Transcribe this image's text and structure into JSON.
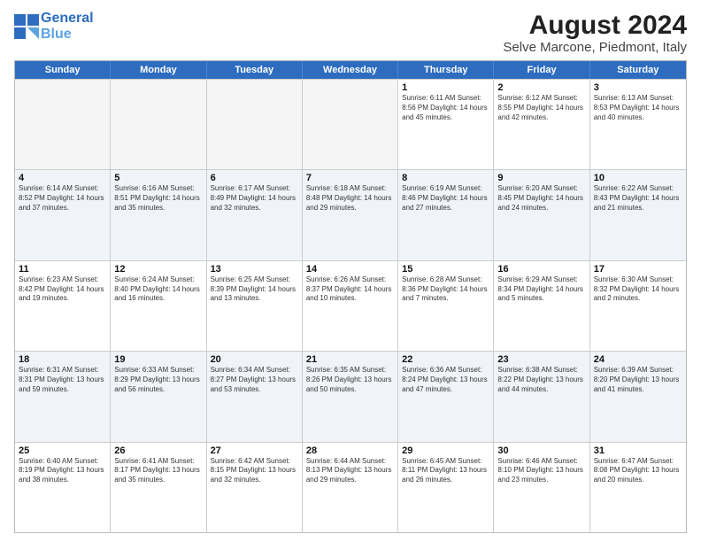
{
  "header": {
    "logo_line1": "General",
    "logo_line2": "Blue",
    "title": "August 2024",
    "subtitle": "Selve Marcone, Piedmont, Italy"
  },
  "weekdays": [
    "Sunday",
    "Monday",
    "Tuesday",
    "Wednesday",
    "Thursday",
    "Friday",
    "Saturday"
  ],
  "rows": [
    [
      {
        "day": "",
        "info": ""
      },
      {
        "day": "",
        "info": ""
      },
      {
        "day": "",
        "info": ""
      },
      {
        "day": "",
        "info": ""
      },
      {
        "day": "1",
        "info": "Sunrise: 6:11 AM\nSunset: 8:56 PM\nDaylight: 14 hours\nand 45 minutes."
      },
      {
        "day": "2",
        "info": "Sunrise: 6:12 AM\nSunset: 8:55 PM\nDaylight: 14 hours\nand 42 minutes."
      },
      {
        "day": "3",
        "info": "Sunrise: 6:13 AM\nSunset: 8:53 PM\nDaylight: 14 hours\nand 40 minutes."
      }
    ],
    [
      {
        "day": "4",
        "info": "Sunrise: 6:14 AM\nSunset: 8:52 PM\nDaylight: 14 hours\nand 37 minutes."
      },
      {
        "day": "5",
        "info": "Sunrise: 6:16 AM\nSunset: 8:51 PM\nDaylight: 14 hours\nand 35 minutes."
      },
      {
        "day": "6",
        "info": "Sunrise: 6:17 AM\nSunset: 8:49 PM\nDaylight: 14 hours\nand 32 minutes."
      },
      {
        "day": "7",
        "info": "Sunrise: 6:18 AM\nSunset: 8:48 PM\nDaylight: 14 hours\nand 29 minutes."
      },
      {
        "day": "8",
        "info": "Sunrise: 6:19 AM\nSunset: 8:46 PM\nDaylight: 14 hours\nand 27 minutes."
      },
      {
        "day": "9",
        "info": "Sunrise: 6:20 AM\nSunset: 8:45 PM\nDaylight: 14 hours\nand 24 minutes."
      },
      {
        "day": "10",
        "info": "Sunrise: 6:22 AM\nSunset: 8:43 PM\nDaylight: 14 hours\nand 21 minutes."
      }
    ],
    [
      {
        "day": "11",
        "info": "Sunrise: 6:23 AM\nSunset: 8:42 PM\nDaylight: 14 hours\nand 19 minutes."
      },
      {
        "day": "12",
        "info": "Sunrise: 6:24 AM\nSunset: 8:40 PM\nDaylight: 14 hours\nand 16 minutes."
      },
      {
        "day": "13",
        "info": "Sunrise: 6:25 AM\nSunset: 8:39 PM\nDaylight: 14 hours\nand 13 minutes."
      },
      {
        "day": "14",
        "info": "Sunrise: 6:26 AM\nSunset: 8:37 PM\nDaylight: 14 hours\nand 10 minutes."
      },
      {
        "day": "15",
        "info": "Sunrise: 6:28 AM\nSunset: 8:36 PM\nDaylight: 14 hours\nand 7 minutes."
      },
      {
        "day": "16",
        "info": "Sunrise: 6:29 AM\nSunset: 8:34 PM\nDaylight: 14 hours\nand 5 minutes."
      },
      {
        "day": "17",
        "info": "Sunrise: 6:30 AM\nSunset: 8:32 PM\nDaylight: 14 hours\nand 2 minutes."
      }
    ],
    [
      {
        "day": "18",
        "info": "Sunrise: 6:31 AM\nSunset: 8:31 PM\nDaylight: 13 hours\nand 59 minutes."
      },
      {
        "day": "19",
        "info": "Sunrise: 6:33 AM\nSunset: 8:29 PM\nDaylight: 13 hours\nand 56 minutes."
      },
      {
        "day": "20",
        "info": "Sunrise: 6:34 AM\nSunset: 8:27 PM\nDaylight: 13 hours\nand 53 minutes."
      },
      {
        "day": "21",
        "info": "Sunrise: 6:35 AM\nSunset: 8:26 PM\nDaylight: 13 hours\nand 50 minutes."
      },
      {
        "day": "22",
        "info": "Sunrise: 6:36 AM\nSunset: 8:24 PM\nDaylight: 13 hours\nand 47 minutes."
      },
      {
        "day": "23",
        "info": "Sunrise: 6:38 AM\nSunset: 8:22 PM\nDaylight: 13 hours\nand 44 minutes."
      },
      {
        "day": "24",
        "info": "Sunrise: 6:39 AM\nSunset: 8:20 PM\nDaylight: 13 hours\nand 41 minutes."
      }
    ],
    [
      {
        "day": "25",
        "info": "Sunrise: 6:40 AM\nSunset: 8:19 PM\nDaylight: 13 hours\nand 38 minutes."
      },
      {
        "day": "26",
        "info": "Sunrise: 6:41 AM\nSunset: 8:17 PM\nDaylight: 13 hours\nand 35 minutes."
      },
      {
        "day": "27",
        "info": "Sunrise: 6:42 AM\nSunset: 8:15 PM\nDaylight: 13 hours\nand 32 minutes."
      },
      {
        "day": "28",
        "info": "Sunrise: 6:44 AM\nSunset: 8:13 PM\nDaylight: 13 hours\nand 29 minutes."
      },
      {
        "day": "29",
        "info": "Sunrise: 6:45 AM\nSunset: 8:11 PM\nDaylight: 13 hours\nand 26 minutes."
      },
      {
        "day": "30",
        "info": "Sunrise: 6:46 AM\nSunset: 8:10 PM\nDaylight: 13 hours\nand 23 minutes."
      },
      {
        "day": "31",
        "info": "Sunrise: 6:47 AM\nSunset: 8:08 PM\nDaylight: 13 hours\nand 20 minutes."
      }
    ]
  ]
}
